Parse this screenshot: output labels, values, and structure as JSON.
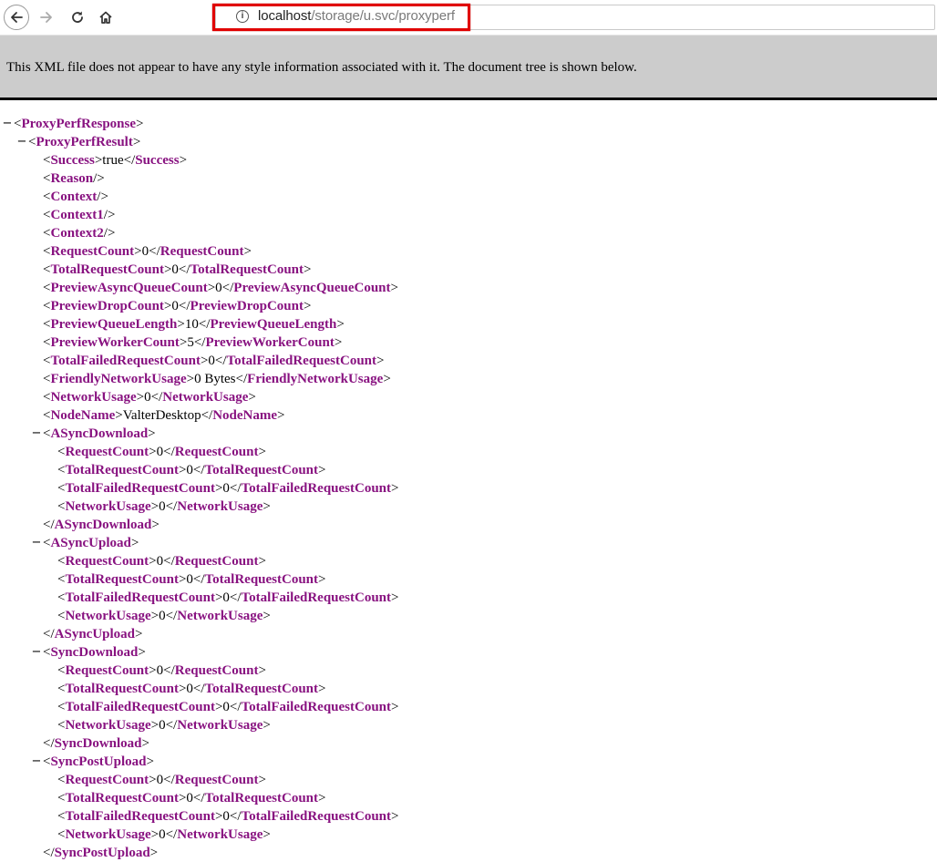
{
  "browser": {
    "url_host": "localhost",
    "url_path": "/storage/u.svc/proxyperf",
    "highlight_color": "#e00000"
  },
  "banner": {
    "text": "This XML file does not appear to have any style information associated with it. The document tree is shown below."
  },
  "xml": {
    "tag_color": "#881280",
    "lines": [
      {
        "depth": 0,
        "kind": "open",
        "collapsible": true,
        "name": "ProxyPerfResponse"
      },
      {
        "depth": 1,
        "kind": "open",
        "collapsible": true,
        "name": "ProxyPerfResult"
      },
      {
        "depth": 2,
        "kind": "leaf",
        "name": "Success",
        "value": "true"
      },
      {
        "depth": 2,
        "kind": "empty",
        "name": "Reason"
      },
      {
        "depth": 2,
        "kind": "empty",
        "name": "Context"
      },
      {
        "depth": 2,
        "kind": "empty",
        "name": "Context1"
      },
      {
        "depth": 2,
        "kind": "empty",
        "name": "Context2"
      },
      {
        "depth": 2,
        "kind": "leaf",
        "name": "RequestCount",
        "value": "0"
      },
      {
        "depth": 2,
        "kind": "leaf",
        "name": "TotalRequestCount",
        "value": "0"
      },
      {
        "depth": 2,
        "kind": "leaf",
        "name": "PreviewAsyncQueueCount",
        "value": "0"
      },
      {
        "depth": 2,
        "kind": "leaf",
        "name": "PreviewDropCount",
        "value": "0"
      },
      {
        "depth": 2,
        "kind": "leaf",
        "name": "PreviewQueueLength",
        "value": "10"
      },
      {
        "depth": 2,
        "kind": "leaf",
        "name": "PreviewWorkerCount",
        "value": "5"
      },
      {
        "depth": 2,
        "kind": "leaf",
        "name": "TotalFailedRequestCount",
        "value": "0"
      },
      {
        "depth": 2,
        "kind": "leaf",
        "name": "FriendlyNetworkUsage",
        "value": "0 Bytes"
      },
      {
        "depth": 2,
        "kind": "leaf",
        "name": "NetworkUsage",
        "value": "0"
      },
      {
        "depth": 2,
        "kind": "leaf",
        "name": "NodeName",
        "value": "ValterDesktop"
      },
      {
        "depth": 2,
        "kind": "open",
        "collapsible": true,
        "name": "ASyncDownload"
      },
      {
        "depth": 3,
        "kind": "leaf",
        "name": "RequestCount",
        "value": "0"
      },
      {
        "depth": 3,
        "kind": "leaf",
        "name": "TotalRequestCount",
        "value": "0"
      },
      {
        "depth": 3,
        "kind": "leaf",
        "name": "TotalFailedRequestCount",
        "value": "0"
      },
      {
        "depth": 3,
        "kind": "leaf",
        "name": "NetworkUsage",
        "value": "0"
      },
      {
        "depth": 2,
        "kind": "close",
        "name": "ASyncDownload"
      },
      {
        "depth": 2,
        "kind": "open",
        "collapsible": true,
        "name": "ASyncUpload"
      },
      {
        "depth": 3,
        "kind": "leaf",
        "name": "RequestCount",
        "value": "0"
      },
      {
        "depth": 3,
        "kind": "leaf",
        "name": "TotalRequestCount",
        "value": "0"
      },
      {
        "depth": 3,
        "kind": "leaf",
        "name": "TotalFailedRequestCount",
        "value": "0"
      },
      {
        "depth": 3,
        "kind": "leaf",
        "name": "NetworkUsage",
        "value": "0"
      },
      {
        "depth": 2,
        "kind": "close",
        "name": "ASyncUpload"
      },
      {
        "depth": 2,
        "kind": "open",
        "collapsible": true,
        "name": "SyncDownload"
      },
      {
        "depth": 3,
        "kind": "leaf",
        "name": "RequestCount",
        "value": "0"
      },
      {
        "depth": 3,
        "kind": "leaf",
        "name": "TotalRequestCount",
        "value": "0"
      },
      {
        "depth": 3,
        "kind": "leaf",
        "name": "TotalFailedRequestCount",
        "value": "0"
      },
      {
        "depth": 3,
        "kind": "leaf",
        "name": "NetworkUsage",
        "value": "0"
      },
      {
        "depth": 2,
        "kind": "close",
        "name": "SyncDownload"
      },
      {
        "depth": 2,
        "kind": "open",
        "collapsible": true,
        "name": "SyncPostUpload"
      },
      {
        "depth": 3,
        "kind": "leaf",
        "name": "RequestCount",
        "value": "0"
      },
      {
        "depth": 3,
        "kind": "leaf",
        "name": "TotalRequestCount",
        "value": "0"
      },
      {
        "depth": 3,
        "kind": "leaf",
        "name": "TotalFailedRequestCount",
        "value": "0"
      },
      {
        "depth": 3,
        "kind": "leaf",
        "name": "NetworkUsage",
        "value": "0"
      },
      {
        "depth": 2,
        "kind": "close",
        "name": "SyncPostUpload"
      }
    ]
  }
}
